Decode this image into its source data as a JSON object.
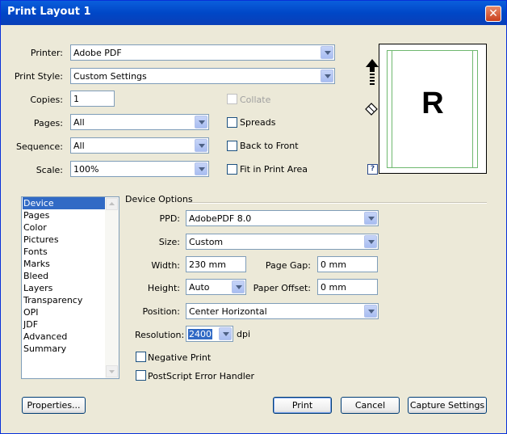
{
  "window": {
    "title": "Print Layout 1",
    "close_glyph": "✕"
  },
  "printer": {
    "label": "Printer:",
    "value": "Adobe PDF"
  },
  "print_style": {
    "label": "Print Style:",
    "value": "Custom Settings"
  },
  "copies": {
    "label": "Copies:",
    "value": "1"
  },
  "pages": {
    "label": "Pages:",
    "value": "All"
  },
  "sequence": {
    "label": "Sequence:",
    "value": "All"
  },
  "scale": {
    "label": "Scale:",
    "value": "100%"
  },
  "checks": {
    "collate": {
      "label": "Collate",
      "checked": false,
      "disabled": true
    },
    "spreads": {
      "label": "Spreads",
      "checked": false
    },
    "back_to_front": {
      "label": "Back to Front",
      "checked": false
    },
    "fit_in_print_area": {
      "label": "Fit in Print Area",
      "checked": false
    },
    "negative_print": {
      "label": "Negative Print",
      "checked": false
    },
    "postscript_error_handler": {
      "label": "PostScript Error Handler",
      "checked": false
    }
  },
  "preview": {
    "letter": "R",
    "help_glyph": "?"
  },
  "sidebar": {
    "items": [
      {
        "label": "Device",
        "selected": true
      },
      {
        "label": "Pages"
      },
      {
        "label": "Color"
      },
      {
        "label": "Pictures"
      },
      {
        "label": "Fonts"
      },
      {
        "label": "Marks"
      },
      {
        "label": "Bleed"
      },
      {
        "label": "Layers"
      },
      {
        "label": "Transparency"
      },
      {
        "label": "OPI"
      },
      {
        "label": "JDF"
      },
      {
        "label": "Advanced"
      },
      {
        "label": "Summary"
      }
    ]
  },
  "device_options": {
    "title": "Device Options",
    "ppd": {
      "label": "PPD:",
      "value": "AdobePDF 8.0"
    },
    "size": {
      "label": "Size:",
      "value": "Custom"
    },
    "width": {
      "label": "Width:",
      "value": "230 mm"
    },
    "page_gap": {
      "label": "Page Gap:",
      "value": "0 mm"
    },
    "height": {
      "label": "Height:",
      "value": "Auto"
    },
    "paper_offset": {
      "label": "Paper Offset:",
      "value": "0 mm"
    },
    "position": {
      "label": "Position:",
      "value": "Center Horizontal"
    },
    "resolution": {
      "label": "Resolution:",
      "value": "2400",
      "unit": "dpi"
    }
  },
  "buttons": {
    "properties": "Properties...",
    "print": "Print",
    "cancel": "Cancel",
    "capture_settings": "Capture Settings"
  },
  "colors": {
    "titlebar": "#0a5fdc",
    "selection": "#316ac5",
    "dialog_bg": "#ece9d8",
    "preview_guides": "#4caf50"
  }
}
